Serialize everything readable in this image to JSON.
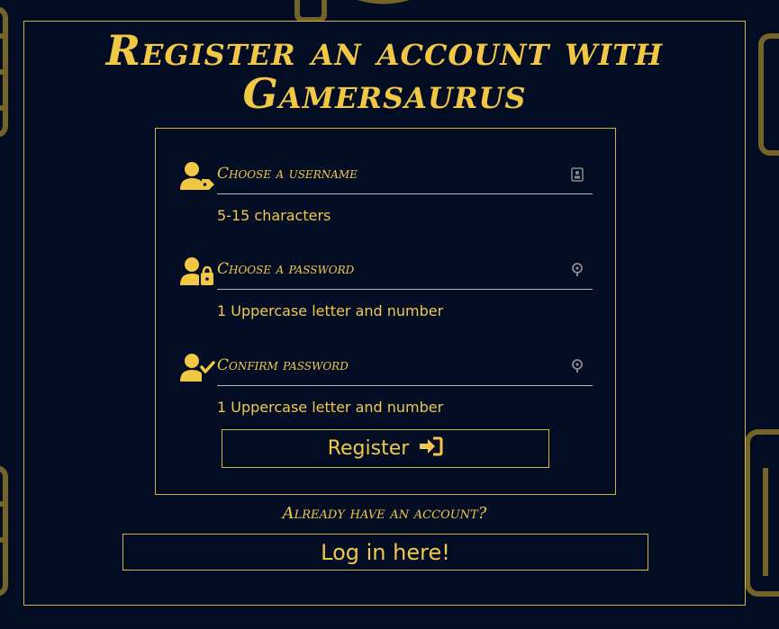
{
  "page": {
    "title": "Register an account with Gamersaurus",
    "accent_color": "#f2c744",
    "background_color": "#020d24"
  },
  "form": {
    "fields": [
      {
        "icon": "user-tag-icon",
        "placeholder": "Choose a username",
        "value": "",
        "trailing_icon": "id-card-icon",
        "hint": "5-15 characters"
      },
      {
        "icon": "user-lock-icon",
        "placeholder": "Choose a password",
        "value": "",
        "trailing_icon": "key-icon",
        "hint": "1 Uppercase letter and number"
      },
      {
        "icon": "user-check-icon",
        "placeholder": "Confirm password",
        "value": "",
        "trailing_icon": "key-icon",
        "hint": "1 Uppercase letter and number"
      }
    ],
    "register_label": "Register",
    "register_icon": "sign-in-icon"
  },
  "login": {
    "prompt": "Already have an account?",
    "button_label": "Log in here!"
  }
}
